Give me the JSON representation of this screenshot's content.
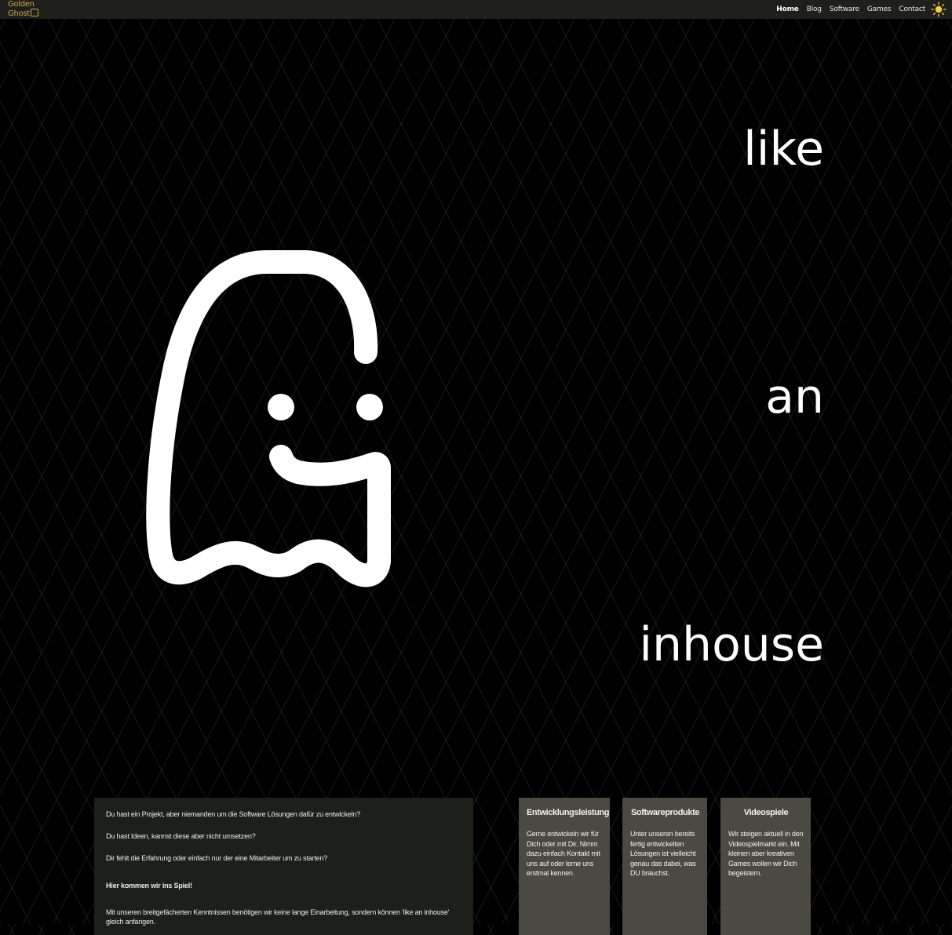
{
  "header": {
    "logo_line1": "Golden",
    "logo_line2": "Ghost",
    "nav": {
      "home": "Home",
      "blog": "Blog",
      "software": "Software",
      "games": "Games",
      "contact": "Contact"
    },
    "theme_icon": "sun-icon",
    "accent_color": "#c9a84c",
    "bar_color": "#1f201c"
  },
  "hero": {
    "word1": "like",
    "word2": "an",
    "word3": "inhouse",
    "ghost_icon": "ghost-icon"
  },
  "intro": {
    "p1": "Du hast ein Projekt, aber niemanden um die Software Lösungen dafür zu entwickeln?",
    "p2": "Du hast Ideen, kannst diese aber nicht umsetzen?",
    "p3": "Dir fehlt die Erfahrung oder einfach nur der eine Mitarbeiter um zu starten?",
    "p4": "Hier kommen wir ins Spiel!",
    "p5": "Mit unseren breitgefächerten Kenntnissen benötigen wir keine lange Einarbeitung, sondern können 'like an inhouse' gleich anfangen."
  },
  "cards": [
    {
      "title": "Entwicklungsleistung",
      "text": "Gerne entwickeln wir für Dich oder mit Dir. Nimm dazu einfach Kontakt mit uns auf oder lerne uns erstmal kennen."
    },
    {
      "title": "Softwareprodukte",
      "text": "Unter unseren bereits fertig entwickelten Lösungen ist vielleicht genau das dabei, was DU brauchst."
    },
    {
      "title": "Videospiele",
      "text": "Wir steigen aktuell in den Videospielmarkt ein. Mit kleinen aber kreativen Games wollen wir Dich begeistern."
    }
  ]
}
